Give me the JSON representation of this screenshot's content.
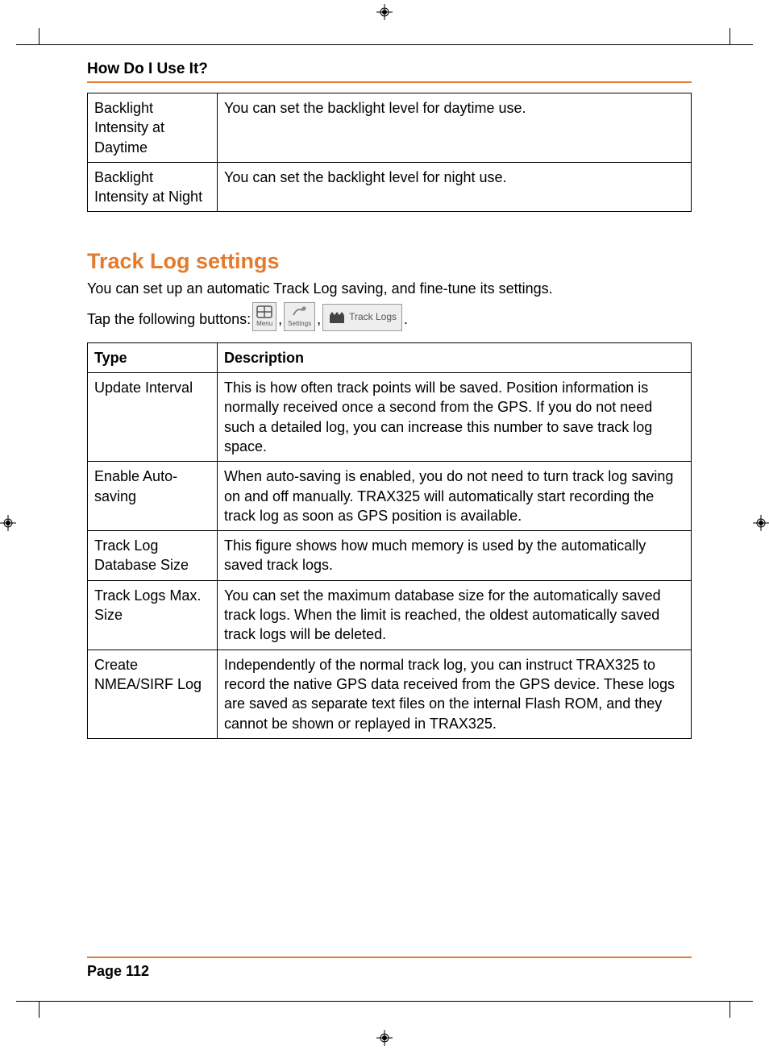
{
  "header": {
    "title": "How Do I Use It?"
  },
  "backlight_table": {
    "rows": [
      {
        "label": "Backlight Intensity at Daytime",
        "desc": "You can set the backlight level for daytime use."
      },
      {
        "label": "Backlight Intensity at Night",
        "desc": "You can set the backlight level for night use."
      }
    ]
  },
  "section": {
    "title": "Track Log settings",
    "intro": "You can set up an automatic Track Log saving, and fine-tune its settings.",
    "tap_prefix": "Tap the following buttons: ",
    "button1_label": "Menu",
    "button2_label": "Settings",
    "button3_label": "Track Logs"
  },
  "track_table": {
    "headers": {
      "type": "Type",
      "desc": "Description"
    },
    "rows": [
      {
        "type": "Update Interval",
        "desc": "This is how often track points will be saved. Position information is normally received once a second from the GPS. If you do not need such a detailed log, you can increase this number to save track log space."
      },
      {
        "type": "Enable Auto-saving",
        "desc": "When auto-saving is enabled, you do not need to turn track log saving on and off manually. TRAX325 will automatically start recording the track log as soon as GPS position is available."
      },
      {
        "type": "Track Log Database Size",
        "desc": "This figure shows how much memory is used by the automatically saved track logs."
      },
      {
        "type": "Track Logs Max. Size",
        "desc": "You can set the maximum database size for the automatically saved track logs. When the limit is reached, the oldest automatically saved track logs will be deleted."
      },
      {
        "type": "Create NMEA/SIRF Log",
        "desc": "Independently of the normal track log, you can instruct TRAX325 to record the native GPS data received from the GPS device. These logs are saved as separate text files on the internal Flash ROM, and they cannot be shown or replayed in TRAX325."
      }
    ]
  },
  "footer": {
    "page": "Page 112"
  }
}
